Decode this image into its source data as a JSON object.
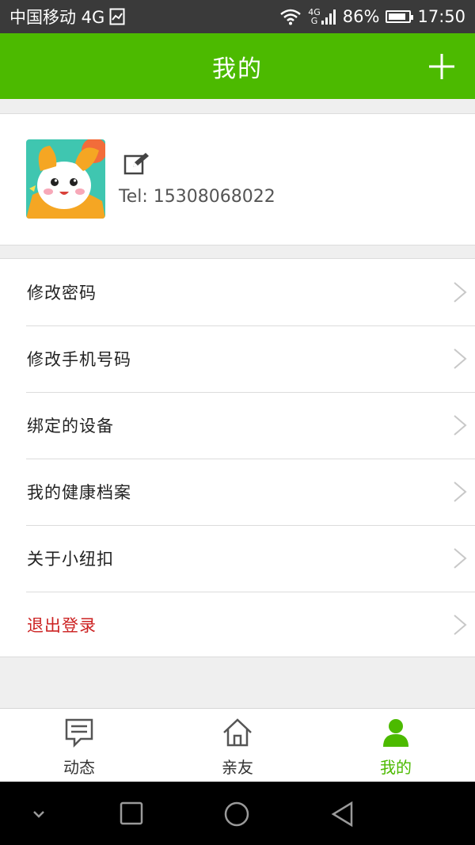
{
  "status_bar": {
    "carrier": "中国移动 4G",
    "net_label_top": "4G",
    "net_label_bottom": "G",
    "battery_percent": "86%",
    "battery_level": 0.86,
    "time": "17:50"
  },
  "header": {
    "title": "我的"
  },
  "profile": {
    "tel": "Tel: 15308068022"
  },
  "menu": {
    "items": [
      {
        "label": "修改密码"
      },
      {
        "label": "修改手机号码"
      },
      {
        "label": "绑定的设备"
      },
      {
        "label": "我的健康档案"
      },
      {
        "label": "关于小纽扣"
      },
      {
        "label": "退出登录"
      }
    ]
  },
  "bottom_nav": {
    "items": [
      {
        "label": "动态"
      },
      {
        "label": "亲友"
      },
      {
        "label": "我的"
      }
    ]
  },
  "colors": {
    "accent": "#4cba00",
    "danger": "#cc2222"
  },
  "icons": {
    "status": [
      "sim-card-icon",
      "wifi-icon",
      "signal-icon",
      "battery-icon"
    ],
    "header": "plus-icon",
    "profile": "edit-icon",
    "menu": "chevron-right-icon",
    "nav": [
      "message-icon",
      "home-icon",
      "person-icon"
    ],
    "system": [
      "chevron-down-icon",
      "square-icon",
      "circle-icon",
      "back-triangle-icon"
    ]
  }
}
